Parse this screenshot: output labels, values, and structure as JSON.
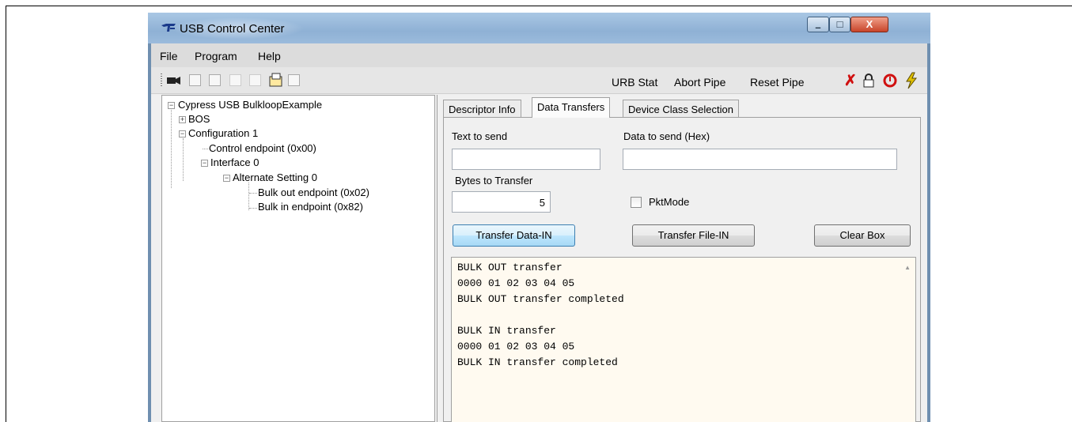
{
  "window": {
    "title": "USB Control Center",
    "controls": {
      "minimize": "–",
      "maximize": "□",
      "close": "X"
    }
  },
  "menu": {
    "file": "File",
    "program": "Program",
    "help": "Help"
  },
  "toolbar": {
    "urb_stat": "URB Stat",
    "abort_pipe": "Abort Pipe",
    "reset_pipe": "Reset Pipe"
  },
  "tree": {
    "root": "Cypress USB BulkloopExample",
    "bos": "BOS",
    "configuration": "Configuration 1",
    "control_endpoint": "Control endpoint (0x00)",
    "interface": "Interface 0",
    "alt_setting": "Alternate Setting 0",
    "bulk_out": "Bulk out endpoint (0x02)",
    "bulk_in": "Bulk in endpoint (0x82)"
  },
  "tabs": {
    "descriptor": "Descriptor Info",
    "data_transfers": "Data Transfers",
    "device_class": "Device Class Selection",
    "active": "Data Transfers"
  },
  "form": {
    "text_to_send_label": "Text to send",
    "text_to_send_value": "",
    "hex_label": "Data to send (Hex)",
    "hex_value": "",
    "bytes_label": "Bytes to Transfer",
    "bytes_value": "5",
    "pktmode_label": "PktMode",
    "pktmode_checked": false
  },
  "buttons": {
    "transfer_data_in": "Transfer Data-IN",
    "transfer_file_in": "Transfer File-IN",
    "clear_box": "Clear Box"
  },
  "output": {
    "lines": [
      "BULK OUT transfer",
      "0000 01 02 03 04 05",
      "BULK OUT transfer completed",
      "",
      "BULK IN transfer",
      "0000 01 02 03 04 05",
      "BULK IN transfer completed"
    ]
  },
  "colors": {
    "accent_red": "#d01010",
    "lightning": "#e0c000",
    "output_bg": "#fffaf0"
  }
}
